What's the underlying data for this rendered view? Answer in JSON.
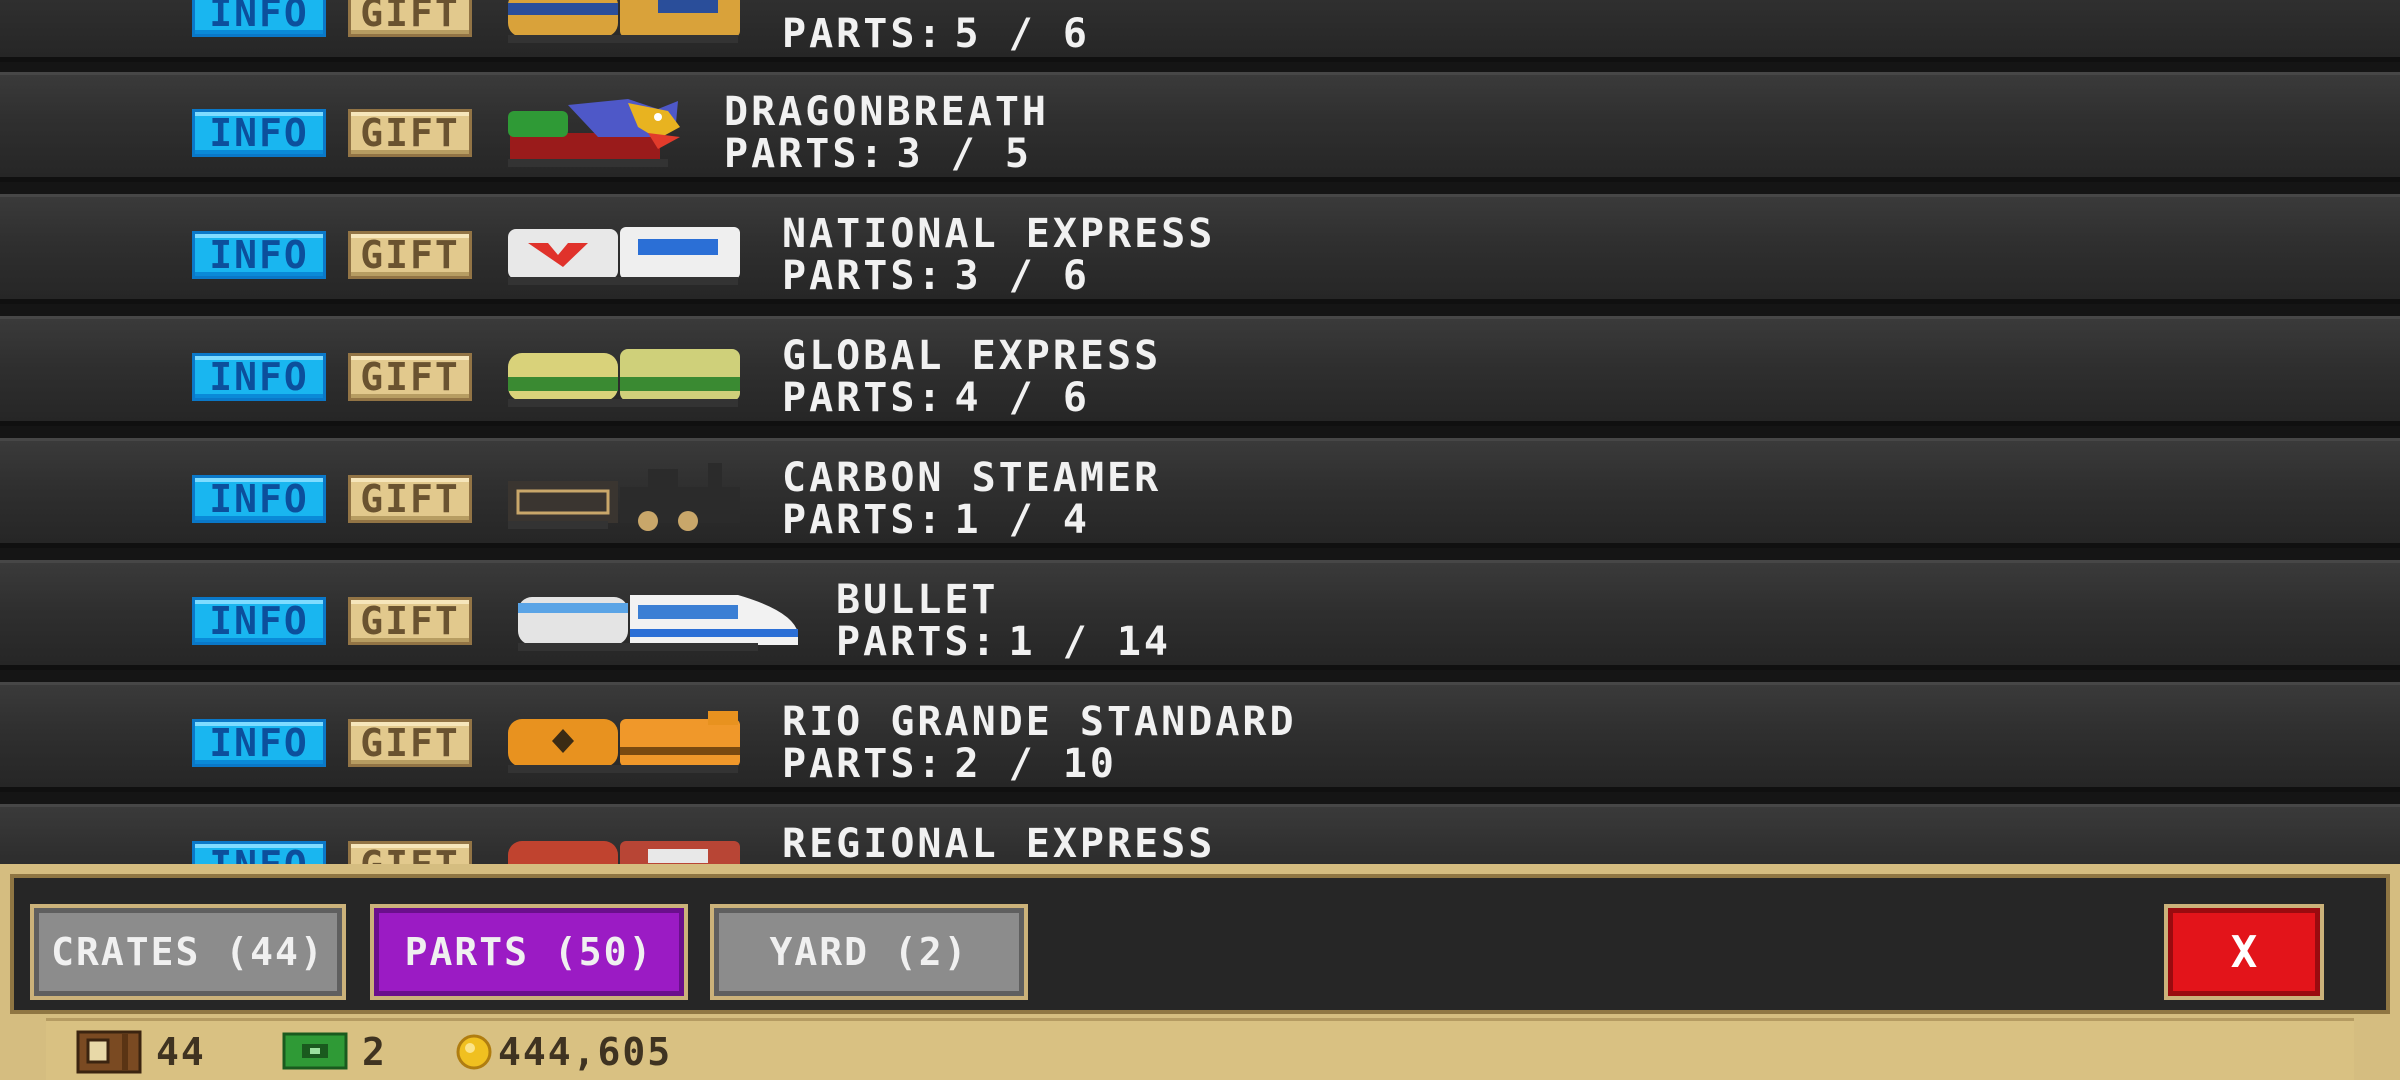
{
  "rows": [
    {
      "name": "",
      "parts_label": "PARTS:",
      "parts_value": "5 / 6",
      "info": "INFO",
      "gift": "GIFT",
      "train": "blue-gold"
    },
    {
      "name": "DRAGONBREATH",
      "parts_label": "PARTS:",
      "parts_value": "3 / 5",
      "info": "INFO",
      "gift": "GIFT",
      "train": "dragon"
    },
    {
      "name": "NATIONAL EXPRESS",
      "parts_label": "PARTS:",
      "parts_value": "3 / 6",
      "info": "INFO",
      "gift": "GIFT",
      "train": "national"
    },
    {
      "name": "GLOBAL EXPRESS",
      "parts_label": "PARTS:",
      "parts_value": "4 / 6",
      "info": "INFO",
      "gift": "GIFT",
      "train": "global"
    },
    {
      "name": "CARBON STEAMER",
      "parts_label": "PARTS:",
      "parts_value": "1 / 4",
      "info": "INFO",
      "gift": "GIFT",
      "train": "steamer"
    },
    {
      "name": "BULLET",
      "parts_label": "PARTS:",
      "parts_value": "1 / 14",
      "info": "INFO",
      "gift": "GIFT",
      "train": "bullet"
    },
    {
      "name": "RIO GRANDE STANDARD",
      "parts_label": "PARTS:",
      "parts_value": "2 / 10",
      "info": "INFO",
      "gift": "GIFT",
      "train": "rio"
    },
    {
      "name": "REGIONAL EXPRESS",
      "parts_label": "",
      "parts_value": "",
      "info": "INFO",
      "gift": "GIFT",
      "train": "regional"
    }
  ],
  "tabs": {
    "crates": "CRATES (44)",
    "parts": "PARTS (50)",
    "yard": "YARD (2)",
    "close": "X"
  },
  "status": {
    "crates_count": "44",
    "cash_count": "2",
    "coins": "444,605"
  },
  "colors": {
    "info_button": "#19b6f0",
    "gift_button": "#e2c98d",
    "active_tab": "#9b1bc4",
    "close_button": "#e3141a",
    "panel_border": "#d5bd80"
  }
}
